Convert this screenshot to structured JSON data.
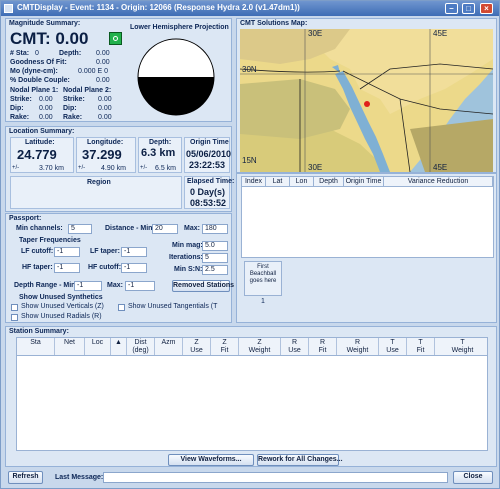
{
  "window": {
    "title": "CMTDisplay - Event: 1134 - Origin: 12066 (Response Hydra 2.0 (v1.47dm1))"
  },
  "magnitude": {
    "section_title": "Magnitude Summary:",
    "cmt_label": "CMT: 0.00",
    "stat_label": "# Sta:",
    "stat_value": "0",
    "depth_label": "Depth:",
    "depth_value": "0.00",
    "goodness_label": "Goodness Of Fit:",
    "goodness_value": "0.00",
    "mo_label": "Mo (dyne-cm):",
    "mo_value": "0.000 E 0",
    "dc_label": "% Double Couple:",
    "dc_value": "0.00",
    "np1_label": "Nodal Plane 1:",
    "np2_label": "Nodal Plane 2:",
    "strike_label": "Strike:",
    "dip_label": "Dip:",
    "rake_label": "Rake:",
    "np1": {
      "strike": "0.00",
      "dip": "0.00",
      "rake": "0.00"
    },
    "np2": {
      "strike": "0.00",
      "dip": "0.00",
      "rake": "0.00"
    }
  },
  "projection": {
    "title": "Lower Hemisphere Projection"
  },
  "map": {
    "title": "CMT Solutions Map:",
    "labels": {
      "lon30_top": "30E",
      "lon45_top": "45E",
      "lat30": "30N",
      "lat15": "15N",
      "lon30_bottom": "30E",
      "lon45_bottom": "45E"
    }
  },
  "location": {
    "section_title": "Location Summary:",
    "lat_label": "Latitude:",
    "lat_value": "24.779",
    "lat_err": "3.70 km",
    "lon_label": "Longitude:",
    "lon_value": "37.299",
    "lon_err": "4.90 km",
    "depth_label": "Depth:",
    "depth_value": "6.3 km",
    "depth_err": "6.5 km",
    "origin_label": "Origin Time",
    "origin_date": "05/06/2010",
    "origin_time": "23:22:53",
    "pm": "+/-",
    "region_label": "Region",
    "elapsed_label": "Elapsed Time:",
    "elapsed_days": "0 Day(s)",
    "elapsed_time": "08:53:52"
  },
  "solutions_table": {
    "columns": [
      "Index",
      "Lat",
      "Lon",
      "Depth",
      "Origin Time",
      "Variance Reduction"
    ]
  },
  "passport": {
    "section_title": "Passport:",
    "min_channels_label": "Min channels:",
    "min_channels": "5",
    "distance_label": "Distance - Min:",
    "distance_min": "20",
    "max_label": "Max:",
    "distance_max": "180",
    "taper_title": "Taper Frequencies",
    "lf_cutoff_label": "LF cutoff:",
    "lf_cutoff": "-1",
    "lf_taper_label": "LF taper:",
    "lf_taper": "-1",
    "hf_taper_label": "HF taper:",
    "hf_taper": "-1",
    "hf_cutoff_label": "HF cutoff:",
    "hf_cutoff": "-1",
    "min_mag_label": "Min mag:",
    "min_mag": "5.0",
    "iterations_label": "Iterations:",
    "iterations": "5",
    "min_sn_label": "Min S:N:",
    "min_sn": "2.5",
    "depth_range_label": "Depth Range - Min:",
    "depth_min": "-1",
    "depth_max_label": "Max:",
    "depth_max": "-1",
    "removed_button": "Removed Stations",
    "unused_title": "Show Unused Synthetics",
    "unused_verticals": "Show Unused Verticals (Z)",
    "unused_tangentials": "Show Unused Tangentials (T",
    "unused_radials": "Show Unused Radials (R)"
  },
  "beachball": {
    "placeholder": "First Beachball goes here",
    "index": "1"
  },
  "station_summary": {
    "section_title": "Station Summary:",
    "columns": [
      {
        "l1": "",
        "l2": "Sta"
      },
      {
        "l1": "",
        "l2": "Net"
      },
      {
        "l1": "",
        "l2": "Loc"
      },
      {
        "l1": "",
        "l2": "▲"
      },
      {
        "l1": "Dist",
        "l2": "(deg)"
      },
      {
        "l1": "",
        "l2": "Azm"
      },
      {
        "l1": "Z",
        "l2": "Use"
      },
      {
        "l1": "Z",
        "l2": "Fit"
      },
      {
        "l1": "Z",
        "l2": "Weight"
      },
      {
        "l1": "R",
        "l2": "Use"
      },
      {
        "l1": "R",
        "l2": "Fit"
      },
      {
        "l1": "R",
        "l2": "Weight"
      },
      {
        "l1": "T",
        "l2": "Use"
      },
      {
        "l1": "T",
        "l2": "Fit"
      },
      {
        "l1": "T",
        "l2": "Weight"
      }
    ],
    "view_button": "View Waveforms...",
    "rework_button": "Rework for All Changes..."
  },
  "footer": {
    "refresh": "Refresh",
    "last_message_label": "Last Message:",
    "last_message": "",
    "close": "Close"
  }
}
